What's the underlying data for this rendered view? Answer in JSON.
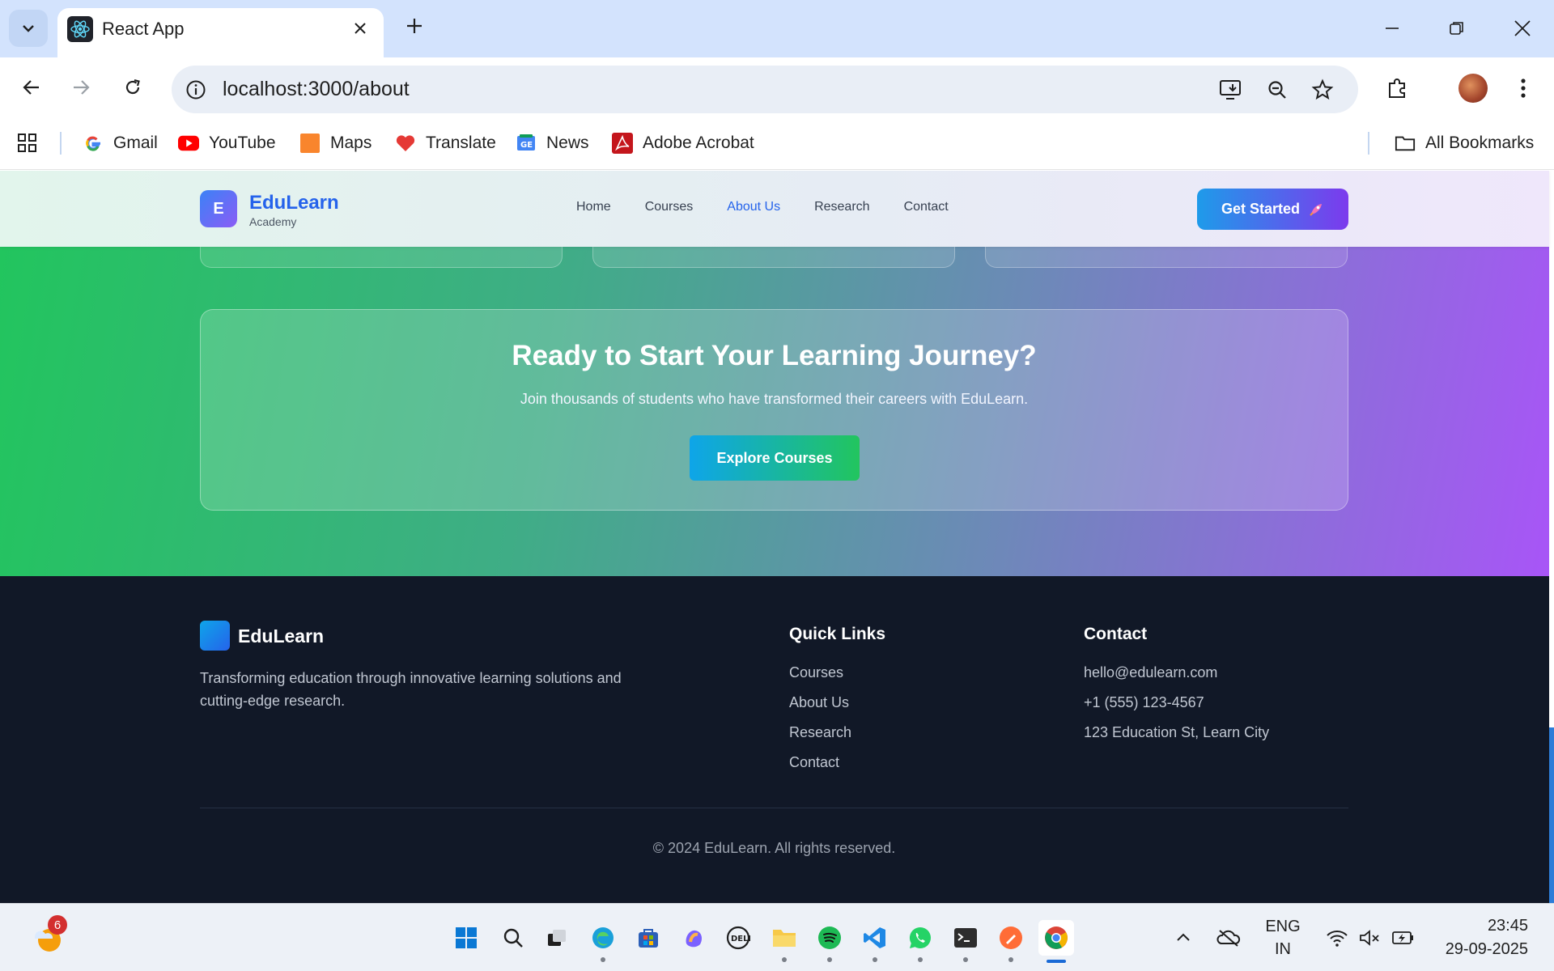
{
  "browser": {
    "tab_title": "React App",
    "url": "localhost:3000/about",
    "bookmarks": [
      "Gmail",
      "YouTube",
      "Maps",
      "Translate",
      "News",
      "Adobe Acrobat"
    ],
    "all_bookmarks": "All Bookmarks"
  },
  "header": {
    "logo_letter": "E",
    "brand": "EduLearn",
    "brand_sub": "Academy",
    "nav": [
      "Home",
      "Courses",
      "About Us",
      "Research",
      "Contact"
    ],
    "active_nav": "About Us",
    "cta": "Get Started"
  },
  "cta_section": {
    "title": "Ready to Start Your Learning Journey?",
    "text": "Join thousands of students who have transformed their careers with EduLearn.",
    "button": "Explore Courses"
  },
  "footer": {
    "brand": "EduLearn",
    "description": "Transforming education through innovative learning solutions and cutting-edge research.",
    "quick_links_title": "Quick Links",
    "quick_links": [
      "Courses",
      "About Us",
      "Research",
      "Contact"
    ],
    "contact_title": "Contact",
    "contact": [
      "hello@edulearn.com",
      "+1 (555) 123-4567",
      "123 Education St, Learn City"
    ],
    "copyright": "© 2024 EduLearn. All rights reserved."
  },
  "taskbar": {
    "weather_badge": "6",
    "lang_line1": "ENG",
    "lang_line2": "IN",
    "time": "23:45",
    "date": "29-09-2025"
  },
  "colors": {
    "accent": "#2563eb",
    "hero_start": "#22c55e",
    "hero_end": "#a855f7",
    "footer_bg": "#111827"
  }
}
